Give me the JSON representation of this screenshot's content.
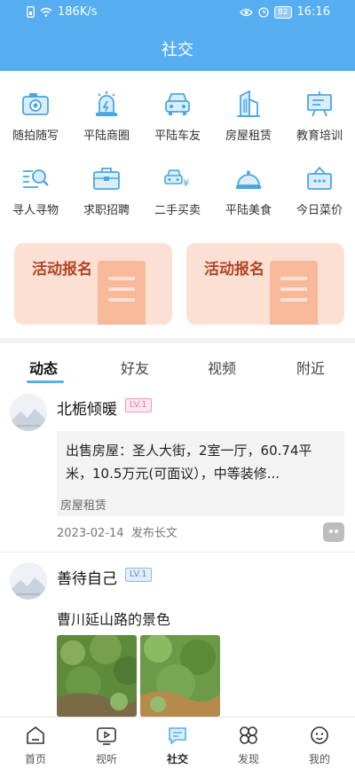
{
  "status_bar": {
    "speed": "186K/s",
    "battery": "82",
    "time": "16:16"
  },
  "header": {
    "title": "社交"
  },
  "grid": [
    {
      "label": "随拍随写",
      "icon": "camera-icon"
    },
    {
      "label": "平陆商圈",
      "icon": "alarm-light-icon"
    },
    {
      "label": "平陆车友",
      "icon": "car-icon"
    },
    {
      "label": "房屋租赁",
      "icon": "building-icon"
    },
    {
      "label": "教育培训",
      "icon": "blackboard-icon"
    },
    {
      "label": "寻人寻物",
      "icon": "search-list-icon"
    },
    {
      "label": "求职招聘",
      "icon": "briefcase-icon"
    },
    {
      "label": "二手买卖",
      "icon": "car-yuan-icon"
    },
    {
      "label": "平陆美食",
      "icon": "food-cloche-icon"
    },
    {
      "label": "今日菜价",
      "icon": "basket-icon"
    }
  ],
  "banners": [
    {
      "text": "活动报名"
    },
    {
      "text": "活动报名"
    }
  ],
  "tabs": [
    "动态",
    "好友",
    "视频",
    "附近"
  ],
  "posts": [
    {
      "user": "北栀倾暖",
      "level": "LV.1",
      "content": "出售房屋：圣人大街，2室一厅，60.74平米，10.5万元(可面议），中等装修...",
      "tag": "房屋租赁",
      "date": "2023-02-14",
      "action": "发布长文"
    },
    {
      "user": "善待自己",
      "level": "LV.1",
      "content": "曹川延山路的景色"
    }
  ],
  "tabbar": [
    {
      "label": "首页",
      "icon": "home-icon"
    },
    {
      "label": "视听",
      "icon": "tv-play-icon"
    },
    {
      "label": "社交",
      "icon": "chat-bubble-icon",
      "active": true
    },
    {
      "label": "发现",
      "icon": "clover-icon"
    },
    {
      "label": "我的",
      "icon": "face-icon"
    }
  ],
  "colors": {
    "primary": "#56aef0",
    "banner": "#fde0d4",
    "banner_text": "#b24424",
    "level_pink": "#f29ab8",
    "level_blue": "#8fb8e8"
  }
}
